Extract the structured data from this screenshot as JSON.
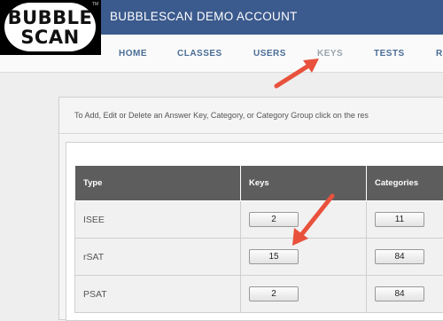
{
  "header": {
    "logo_line1": "BUBBLE",
    "logo_line2": "SCAN",
    "logo_tm": "TM",
    "account_title": "BUBBLESCAN DEMO ACCOUNT"
  },
  "nav": {
    "items": [
      {
        "label": "HOME",
        "active": false
      },
      {
        "label": "CLASSES",
        "active": false
      },
      {
        "label": "USERS",
        "active": false
      },
      {
        "label": "KEYS",
        "active": true
      },
      {
        "label": "TESTS",
        "active": false
      },
      {
        "label": "R",
        "active": false
      }
    ]
  },
  "main": {
    "instructions": "To Add, Edit or Delete an Answer Key, Category, or Category Group click on the res",
    "table": {
      "headers": [
        "Type",
        "Keys",
        "Categories"
      ],
      "rows": [
        {
          "type": "ISEE",
          "keys": "2",
          "categories": "11"
        },
        {
          "type": "rSAT",
          "keys": "15",
          "categories": "84"
        },
        {
          "type": "PSAT",
          "keys": "2",
          "categories": "84"
        }
      ]
    }
  },
  "colors": {
    "header_bg": "#3b5a8d",
    "nav_text": "#4a6d96",
    "table_header_bg": "#5d5d5d",
    "annotation_arrow": "#e8513c"
  }
}
